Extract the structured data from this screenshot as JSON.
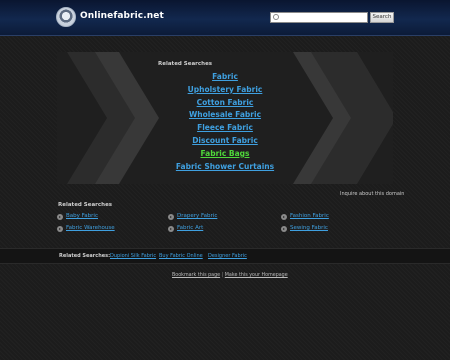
{
  "header": {
    "site_name": "Onlinefabric.net",
    "search_placeholder": "",
    "search_button": "Search"
  },
  "main": {
    "heading": "Related Searches",
    "links": [
      {
        "label": "Fabric"
      },
      {
        "label": "Upholstery Fabric"
      },
      {
        "label": "Cotton Fabric"
      },
      {
        "label": "Wholesale Fabric"
      },
      {
        "label": "Fleece Fabric"
      },
      {
        "label": "Discount Fabric"
      },
      {
        "label": "Fabric Bags",
        "color": "#4fd93b"
      },
      {
        "label": "Fabric Shower Curtains"
      }
    ],
    "inquire": "Inquire about this domain"
  },
  "related": {
    "heading": "Related Searches",
    "items": [
      "Baby Fabric",
      "Drapery Fabric",
      "Fashion Fabric",
      "Fabric Warehouse",
      "Fabric Art",
      "Sewing Fabric"
    ]
  },
  "bottom_bar": {
    "label": "Related Searches:",
    "links": [
      "Dupioni Silk Fabric",
      "Buy Fabric Online",
      "Designer Fabric"
    ]
  },
  "footer": {
    "bookmark": "Bookmark this page",
    "separator": "|",
    "homepage": "Make this your Homepage"
  },
  "colors": {
    "link": "#3fa0e0",
    "highlight_link": "#4fd93b",
    "header_bg": "#12284e"
  }
}
